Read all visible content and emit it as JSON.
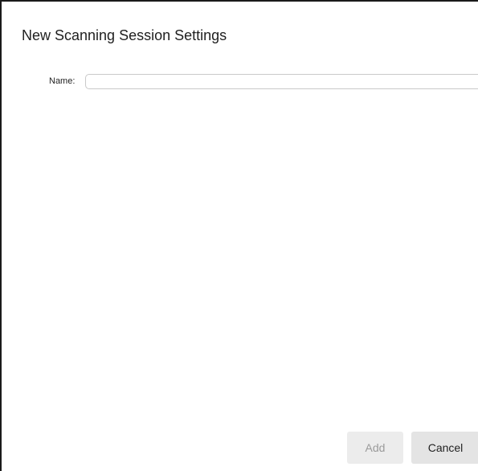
{
  "dialog": {
    "title": "New Scanning Session Settings",
    "name_label": "Name:",
    "name_value": "",
    "name_placeholder": ""
  },
  "buttons": {
    "add_label": "Add",
    "add_enabled": false,
    "cancel_label": "Cancel"
  }
}
